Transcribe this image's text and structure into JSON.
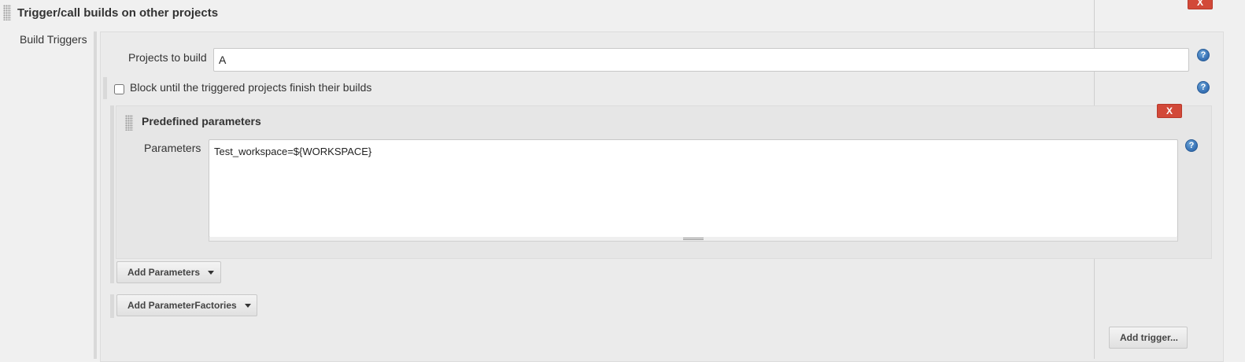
{
  "section": {
    "title": "Trigger/call builds on other projects",
    "close_label": "X"
  },
  "build_triggers": {
    "label": "Build Triggers",
    "projects_label": "Projects to build",
    "projects_value": "A",
    "block_label": "Block until the triggered projects finish their builds",
    "block_checked": false,
    "help_label": "?"
  },
  "predefined": {
    "title": "Predefined parameters",
    "close_label": "X",
    "parameters_label": "Parameters",
    "parameters_value": "Test_workspace=${WORKSPACE}"
  },
  "buttons": {
    "add_parameters": "Add Parameters",
    "add_parameter_factories": "Add ParameterFactories",
    "add_trigger": "Add trigger..."
  },
  "colors": {
    "close_button": "#d24939",
    "help_icon": "#3a75b8"
  }
}
